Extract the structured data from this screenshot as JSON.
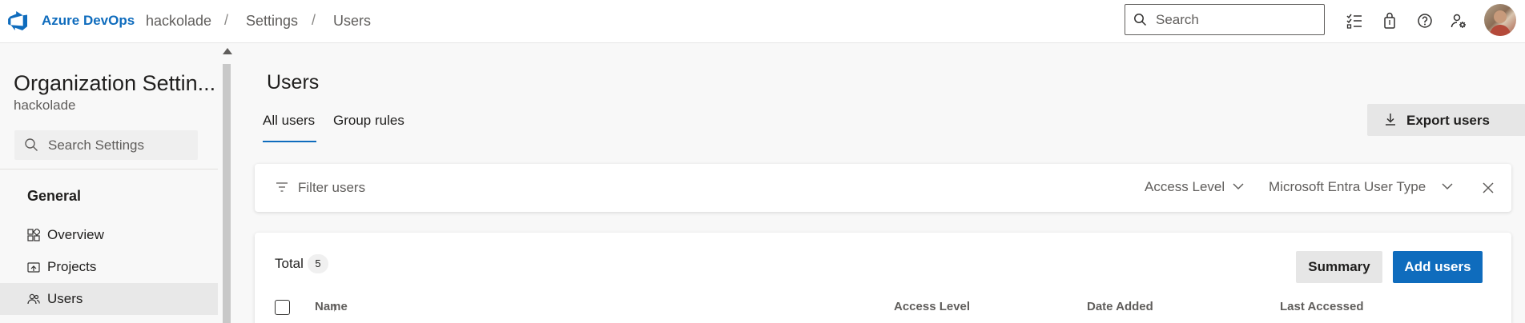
{
  "header": {
    "brand": "Azure DevOps",
    "breadcrumbs": [
      "hackolade",
      "Settings",
      "Users"
    ],
    "separator": "/",
    "search_placeholder": "Search",
    "icons": [
      "task-list-icon",
      "shopping-bag-icon",
      "help-icon",
      "user-settings-icon"
    ]
  },
  "sidebar": {
    "title": "Organization Settin...",
    "subtitle": "hackolade",
    "search_placeholder": "Search Settings",
    "section": "General",
    "items": [
      {
        "label": "Overview",
        "icon": "overview-icon",
        "active": false
      },
      {
        "label": "Projects",
        "icon": "projects-icon",
        "active": false
      },
      {
        "label": "Users",
        "icon": "users-icon",
        "active": true
      }
    ]
  },
  "main": {
    "title": "Users",
    "tabs": [
      {
        "label": "All users",
        "active": true
      },
      {
        "label": "Group rules",
        "active": false
      }
    ],
    "export_label": "Export users",
    "filter": {
      "placeholder": "Filter users",
      "access_level": "Access Level",
      "user_type": "Microsoft Entra User Type"
    },
    "list": {
      "total_label": "Total",
      "total_count": "5",
      "summary_label": "Summary",
      "add_label": "Add users",
      "columns": [
        "Name",
        "Access Level",
        "Date Added",
        "Last Accessed"
      ],
      "sort_indicator": "↑"
    }
  },
  "colors": {
    "accent": "#0f6cbd",
    "background": "#f8f8f8"
  }
}
